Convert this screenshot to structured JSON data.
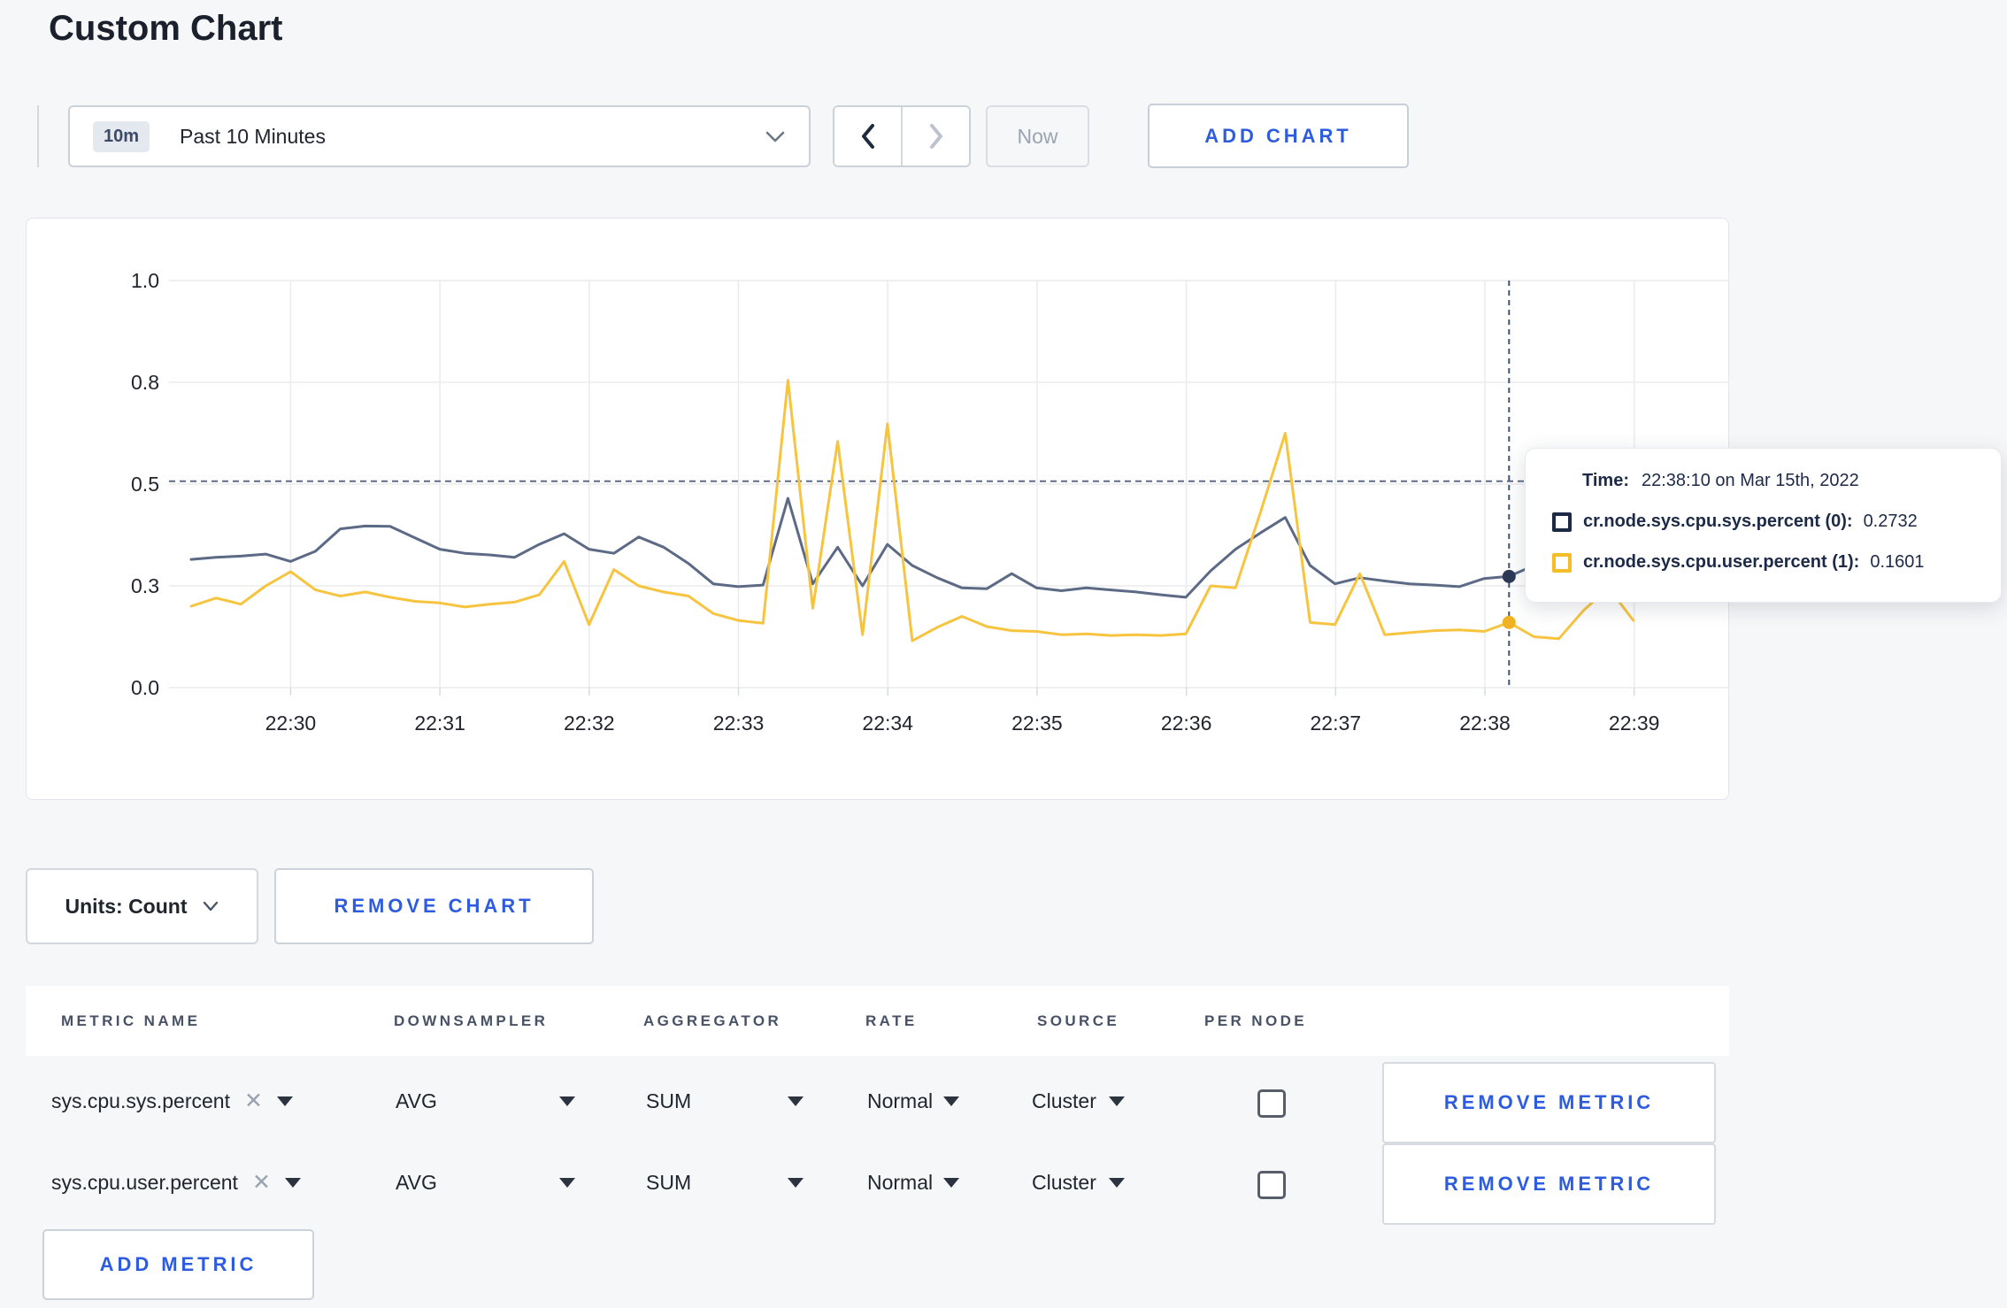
{
  "page": {
    "title": "Custom Chart"
  },
  "colors": {
    "accent_blue": "#2d5ce0",
    "series_sys": "#5c6a85",
    "series_user": "#f7c440",
    "crosshair": "#42526e",
    "gridline": "#e9ebee"
  },
  "toolbar": {
    "time_badge": "10m",
    "time_label": "Past 10 Minutes",
    "prev_icon": "chevron-left",
    "next_icon": "chevron-right",
    "now_label": "Now",
    "add_chart_label": "ADD CHART"
  },
  "chart_data": {
    "type": "line",
    "title": "",
    "xlabel": "",
    "ylabel": "",
    "x_axis": {
      "tick_labels": [
        "22:30",
        "22:31",
        "22:32",
        "22:33",
        "22:34",
        "22:35",
        "22:36",
        "22:37",
        "22:38",
        "22:39"
      ],
      "start_time": "22:29:20",
      "interval_seconds": 10
    },
    "y_axis": {
      "min": 0,
      "max": 1,
      "gridline_values": [
        0,
        0.25,
        0.5,
        0.75,
        1
      ],
      "gridline_labels": [
        "0.0",
        "0.3",
        "0.5",
        "0.8",
        "1.0"
      ]
    },
    "grid": true,
    "legend_position": "tooltip",
    "series": [
      {
        "name": "cr.node.sys.cpu.sys.percent",
        "color": "#5c6a85",
        "marker_color": "#2c3a58",
        "values": [
          0.315,
          0.32,
          0.323,
          0.328,
          0.31,
          0.335,
          0.39,
          0.397,
          0.396,
          0.368,
          0.34,
          0.33,
          0.326,
          0.32,
          0.352,
          0.378,
          0.34,
          0.33,
          0.37,
          0.345,
          0.305,
          0.255,
          0.248,
          0.252,
          0.465,
          0.255,
          0.345,
          0.25,
          0.352,
          0.3,
          0.27,
          0.245,
          0.243,
          0.28,
          0.245,
          0.238,
          0.245,
          0.24,
          0.235,
          0.228,
          0.222,
          0.287,
          0.34,
          0.38,
          0.418,
          0.3,
          0.255,
          0.27,
          0.262,
          0.255,
          0.252,
          0.248,
          0.268,
          0.2732,
          0.3,
          0.285,
          0.27,
          0.265,
          0.268
        ]
      },
      {
        "name": "cr.node.sys.cpu.user.percent",
        "color": "#f7c440",
        "marker_color": "#eeb222",
        "values": [
          0.2,
          0.22,
          0.205,
          0.25,
          0.285,
          0.24,
          0.225,
          0.235,
          0.222,
          0.212,
          0.208,
          0.198,
          0.205,
          0.21,
          0.228,
          0.31,
          0.155,
          0.29,
          0.25,
          0.235,
          0.225,
          0.182,
          0.165,
          0.158,
          0.755,
          0.195,
          0.605,
          0.13,
          0.648,
          0.115,
          0.148,
          0.175,
          0.15,
          0.14,
          0.138,
          0.13,
          0.132,
          0.128,
          0.13,
          0.128,
          0.132,
          0.25,
          0.245,
          0.43,
          0.625,
          0.16,
          0.155,
          0.28,
          0.13,
          0.135,
          0.14,
          0.142,
          0.138,
          0.1601,
          0.125,
          0.12,
          0.19,
          0.245,
          0.165
        ]
      }
    ],
    "crosshair": {
      "point_index": 53,
      "time": "22:38:10",
      "h_line_value": 0.507
    }
  },
  "tooltip": {
    "time_label": "Time:",
    "time_value": "22:38:10 on Mar 15th, 2022",
    "rows": [
      {
        "label": "cr.node.sys.cpu.sys.percent (0):",
        "value": "0.2732",
        "swatch_color": "#1d2a47"
      },
      {
        "label": "cr.node.sys.cpu.user.percent (1):",
        "value": "0.1601",
        "swatch_color": "#f5bd27"
      }
    ]
  },
  "chart_controls": {
    "units_label": "Units: Count",
    "remove_chart_label": "REMOVE CHART"
  },
  "metrics_table": {
    "headers": [
      "METRIC NAME",
      "DOWNSAMPLER",
      "AGGREGATOR",
      "RATE",
      "SOURCE",
      "PER NODE"
    ],
    "rows": [
      {
        "metric_name": "sys.cpu.sys.percent",
        "downsampler": "AVG",
        "aggregator": "SUM",
        "rate": "Normal",
        "source": "Cluster",
        "per_node_checked": false,
        "remove_label": "REMOVE METRIC"
      },
      {
        "metric_name": "sys.cpu.user.percent",
        "downsampler": "AVG",
        "aggregator": "SUM",
        "rate": "Normal",
        "source": "Cluster",
        "per_node_checked": false,
        "remove_label": "REMOVE METRIC"
      }
    ],
    "add_metric_label": "ADD METRIC"
  }
}
